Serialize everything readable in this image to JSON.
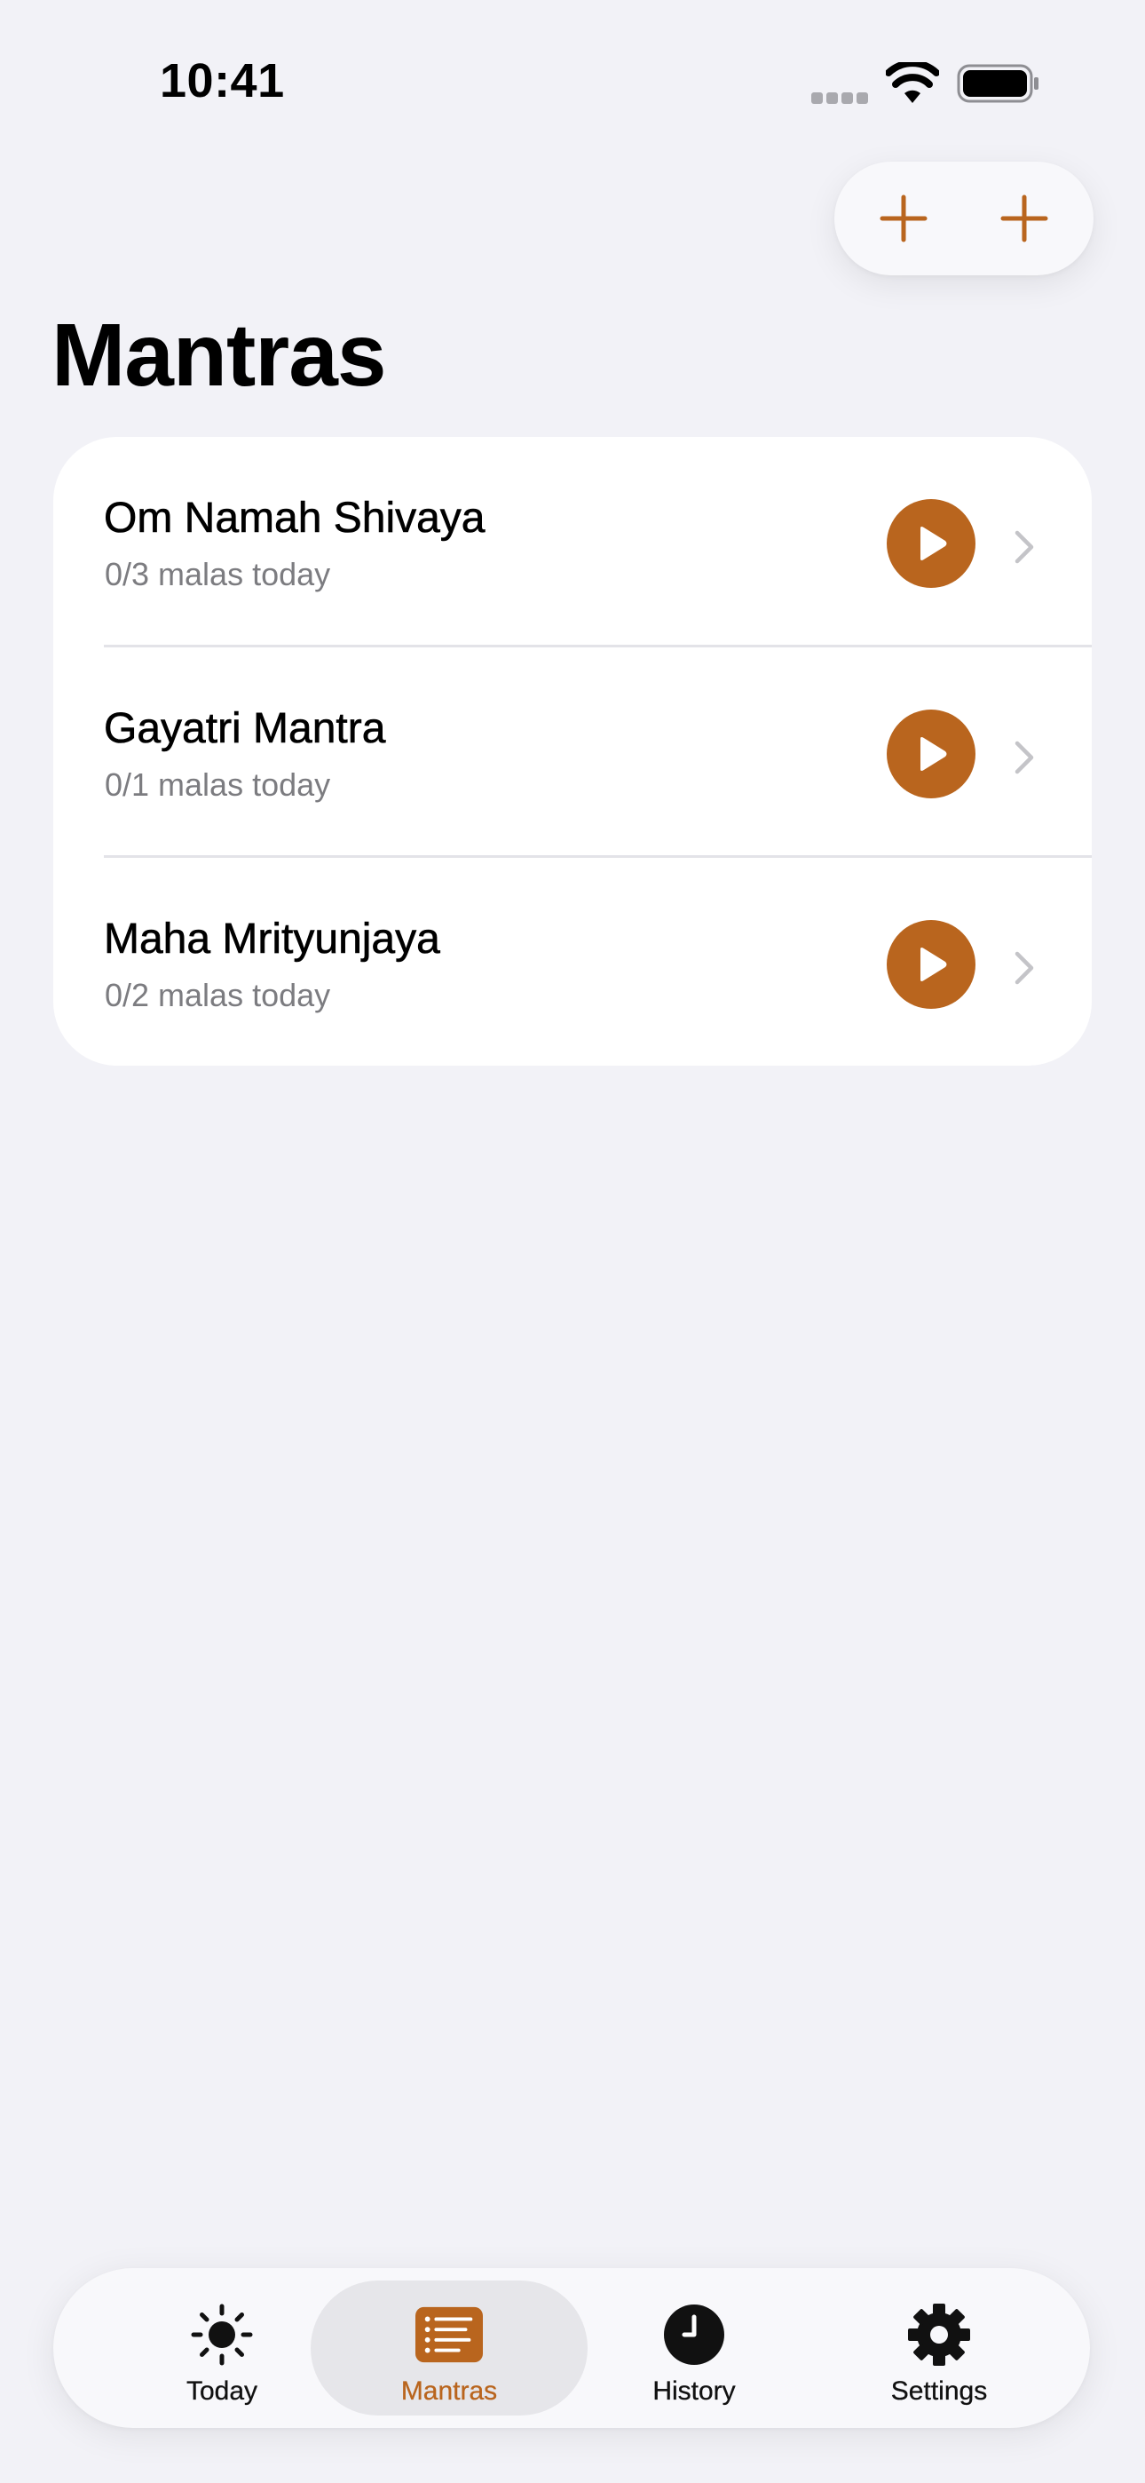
{
  "status_bar": {
    "time": "10:41"
  },
  "colors": {
    "accent": "#b9651e",
    "background": "#f2f2f7",
    "card": "#ffffff",
    "secondary_text": "#7c7c80"
  },
  "toolbar": {
    "buttons": [
      {
        "icon": "plus-icon"
      },
      {
        "icon": "plus-icon"
      }
    ]
  },
  "page": {
    "title": "Mantras"
  },
  "mantras": [
    {
      "name": "Om Namah Shivaya",
      "progress": "0/3 malas today"
    },
    {
      "name": "Gayatri Mantra",
      "progress": "0/1 malas today"
    },
    {
      "name": "Maha Mrityunjaya",
      "progress": "0/2 malas today"
    }
  ],
  "tab_bar": {
    "selected": "Mantras",
    "tabs": [
      {
        "label": "Today",
        "icon": "sun-icon"
      },
      {
        "label": "Mantras",
        "icon": "list-icon"
      },
      {
        "label": "History",
        "icon": "clock-icon"
      },
      {
        "label": "Settings",
        "icon": "gear-icon"
      }
    ]
  }
}
